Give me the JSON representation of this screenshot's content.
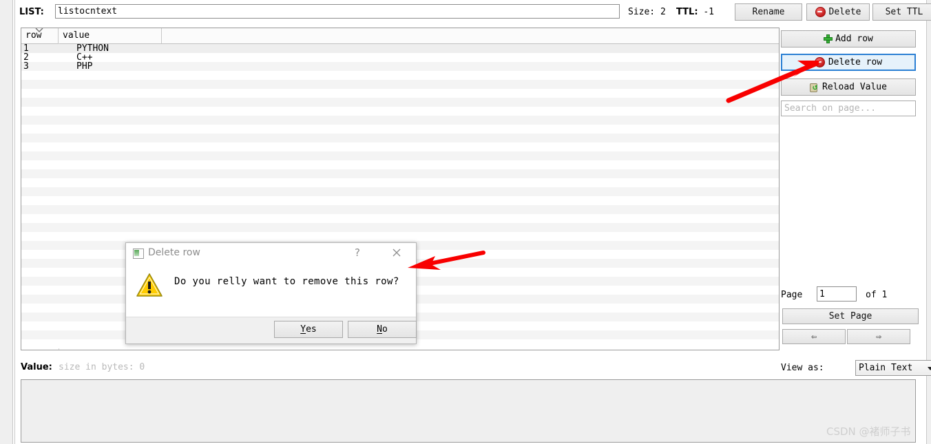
{
  "topbar": {
    "list_label": "LIST:",
    "list_name_value": "listocntext",
    "size_text": "Size: 2",
    "ttl_bold": "TTL:",
    "ttl_value": "-1",
    "rename_label": "Rename",
    "delete_label": "Delete",
    "set_ttl_label": "Set TTL"
  },
  "table": {
    "columns": [
      "row",
      "value"
    ],
    "sort_indicator": "descending",
    "rows": [
      {
        "row": "1",
        "value": "PYTHON"
      },
      {
        "row": "2",
        "value": "C++"
      },
      {
        "row": "3",
        "value": "PHP"
      }
    ]
  },
  "side": {
    "add_row_label": "Add row",
    "delete_row_label": "Delete row",
    "reload_value_label": "Reload Value",
    "search_placeholder": "Search on page...",
    "search_value": ""
  },
  "pager": {
    "page_label": "Page",
    "page_value": "1",
    "of_text": "of 1",
    "set_page_label": "Set Page",
    "prev_glyph": "⇦",
    "next_glyph": "⇨"
  },
  "value_panel": {
    "value_label": "Value:",
    "value_meta": "size in bytes: 0",
    "view_as_label": "View as:",
    "view_as_selected": "Plain Text",
    "view_as_options": [
      "Plain Text"
    ],
    "content": ""
  },
  "dialog": {
    "title": "Delete row",
    "help_glyph": "?",
    "close_glyph": "✕",
    "message": "Do you relly want to remove this row?",
    "yes_label": "Yes",
    "yes_mnemonic": "Y",
    "yes_rest": "es",
    "no_label": "No",
    "no_mnemonic": "N",
    "no_rest": "o"
  },
  "annotations": {
    "arrow_to_delete_row": "red-arrow-pointing-to-delete-row-button",
    "arrow_to_dialog": "red-arrow-pointing-to-delete-row-dialog",
    "watermark": "CSDN @褚师子书"
  },
  "colors": {
    "highlight_border": "#2a7fd4",
    "highlight_fill": "#e6f2fb",
    "annotation_red": "#f80000",
    "delete_icon_red": "#c41b1b",
    "add_icon_green": "#35b035",
    "warning_yellow": "#ffcc00"
  }
}
